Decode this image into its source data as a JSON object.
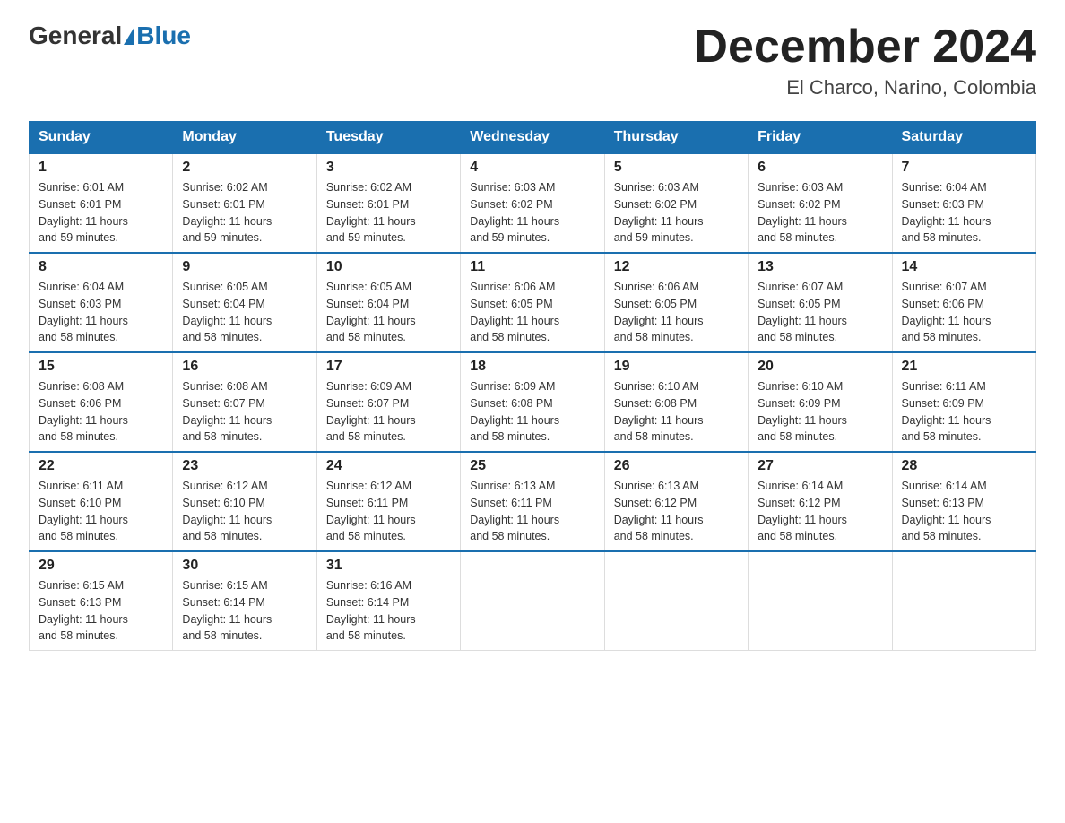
{
  "header": {
    "logo_general": "General",
    "logo_blue": "Blue",
    "month_title": "December 2024",
    "location": "El Charco, Narino, Colombia"
  },
  "days_of_week": [
    "Sunday",
    "Monday",
    "Tuesday",
    "Wednesday",
    "Thursday",
    "Friday",
    "Saturday"
  ],
  "weeks": [
    [
      {
        "day": "1",
        "sunrise": "6:01 AM",
        "sunset": "6:01 PM",
        "daylight": "11 hours and 59 minutes."
      },
      {
        "day": "2",
        "sunrise": "6:02 AM",
        "sunset": "6:01 PM",
        "daylight": "11 hours and 59 minutes."
      },
      {
        "day": "3",
        "sunrise": "6:02 AM",
        "sunset": "6:01 PM",
        "daylight": "11 hours and 59 minutes."
      },
      {
        "day": "4",
        "sunrise": "6:03 AM",
        "sunset": "6:02 PM",
        "daylight": "11 hours and 59 minutes."
      },
      {
        "day": "5",
        "sunrise": "6:03 AM",
        "sunset": "6:02 PM",
        "daylight": "11 hours and 59 minutes."
      },
      {
        "day": "6",
        "sunrise": "6:03 AM",
        "sunset": "6:02 PM",
        "daylight": "11 hours and 58 minutes."
      },
      {
        "day": "7",
        "sunrise": "6:04 AM",
        "sunset": "6:03 PM",
        "daylight": "11 hours and 58 minutes."
      }
    ],
    [
      {
        "day": "8",
        "sunrise": "6:04 AM",
        "sunset": "6:03 PM",
        "daylight": "11 hours and 58 minutes."
      },
      {
        "day": "9",
        "sunrise": "6:05 AM",
        "sunset": "6:04 PM",
        "daylight": "11 hours and 58 minutes."
      },
      {
        "day": "10",
        "sunrise": "6:05 AM",
        "sunset": "6:04 PM",
        "daylight": "11 hours and 58 minutes."
      },
      {
        "day": "11",
        "sunrise": "6:06 AM",
        "sunset": "6:05 PM",
        "daylight": "11 hours and 58 minutes."
      },
      {
        "day": "12",
        "sunrise": "6:06 AM",
        "sunset": "6:05 PM",
        "daylight": "11 hours and 58 minutes."
      },
      {
        "day": "13",
        "sunrise": "6:07 AM",
        "sunset": "6:05 PM",
        "daylight": "11 hours and 58 minutes."
      },
      {
        "day": "14",
        "sunrise": "6:07 AM",
        "sunset": "6:06 PM",
        "daylight": "11 hours and 58 minutes."
      }
    ],
    [
      {
        "day": "15",
        "sunrise": "6:08 AM",
        "sunset": "6:06 PM",
        "daylight": "11 hours and 58 minutes."
      },
      {
        "day": "16",
        "sunrise": "6:08 AM",
        "sunset": "6:07 PM",
        "daylight": "11 hours and 58 minutes."
      },
      {
        "day": "17",
        "sunrise": "6:09 AM",
        "sunset": "6:07 PM",
        "daylight": "11 hours and 58 minutes."
      },
      {
        "day": "18",
        "sunrise": "6:09 AM",
        "sunset": "6:08 PM",
        "daylight": "11 hours and 58 minutes."
      },
      {
        "day": "19",
        "sunrise": "6:10 AM",
        "sunset": "6:08 PM",
        "daylight": "11 hours and 58 minutes."
      },
      {
        "day": "20",
        "sunrise": "6:10 AM",
        "sunset": "6:09 PM",
        "daylight": "11 hours and 58 minutes."
      },
      {
        "day": "21",
        "sunrise": "6:11 AM",
        "sunset": "6:09 PM",
        "daylight": "11 hours and 58 minutes."
      }
    ],
    [
      {
        "day": "22",
        "sunrise": "6:11 AM",
        "sunset": "6:10 PM",
        "daylight": "11 hours and 58 minutes."
      },
      {
        "day": "23",
        "sunrise": "6:12 AM",
        "sunset": "6:10 PM",
        "daylight": "11 hours and 58 minutes."
      },
      {
        "day": "24",
        "sunrise": "6:12 AM",
        "sunset": "6:11 PM",
        "daylight": "11 hours and 58 minutes."
      },
      {
        "day": "25",
        "sunrise": "6:13 AM",
        "sunset": "6:11 PM",
        "daylight": "11 hours and 58 minutes."
      },
      {
        "day": "26",
        "sunrise": "6:13 AM",
        "sunset": "6:12 PM",
        "daylight": "11 hours and 58 minutes."
      },
      {
        "day": "27",
        "sunrise": "6:14 AM",
        "sunset": "6:12 PM",
        "daylight": "11 hours and 58 minutes."
      },
      {
        "day": "28",
        "sunrise": "6:14 AM",
        "sunset": "6:13 PM",
        "daylight": "11 hours and 58 minutes."
      }
    ],
    [
      {
        "day": "29",
        "sunrise": "6:15 AM",
        "sunset": "6:13 PM",
        "daylight": "11 hours and 58 minutes."
      },
      {
        "day": "30",
        "sunrise": "6:15 AM",
        "sunset": "6:14 PM",
        "daylight": "11 hours and 58 minutes."
      },
      {
        "day": "31",
        "sunrise": "6:16 AM",
        "sunset": "6:14 PM",
        "daylight": "11 hours and 58 minutes."
      },
      null,
      null,
      null,
      null
    ]
  ],
  "labels": {
    "sunrise": "Sunrise:",
    "sunset": "Sunset:",
    "daylight": "Daylight:"
  }
}
